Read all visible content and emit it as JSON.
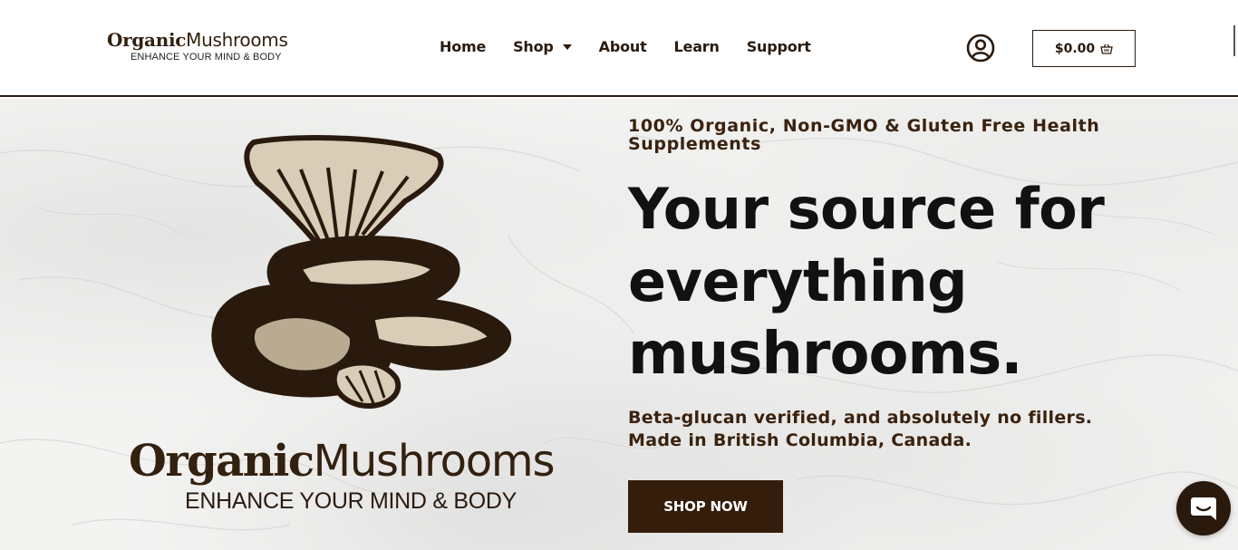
{
  "header": {
    "logo": {
      "title_bold": "Organic",
      "title_light": "Mushrooms",
      "tagline": "ENHANCE YOUR MIND & BODY"
    },
    "nav": [
      {
        "label": "Home"
      },
      {
        "label": "Shop",
        "has_dropdown": true
      },
      {
        "label": "About"
      },
      {
        "label": "Learn"
      },
      {
        "label": "Support"
      }
    ],
    "account_icon": "user-circle-icon",
    "cart": {
      "total": "$0.00",
      "icon": "basket-icon"
    }
  },
  "hero": {
    "eyebrow": "100% Organic, Non-GMO & Gluten Free Health Supplements",
    "headline": {
      "line1": "Your source for",
      "line2": "everything",
      "line3": "mushrooms."
    },
    "subtext_line1": "Beta-glucan verified, and absolutely no fillers.",
    "subtext_line2": "Made in British Columbia, Canada.",
    "cta_label": "SHOP NOW",
    "brand": {
      "title_bold": "Organic",
      "title_light": "Mushrooms",
      "tagline": "ENHANCE YOUR MIND & BODY"
    }
  },
  "chat": {
    "icon": "chat-bubble-icon"
  },
  "colors": {
    "brand_brown": "#341d0b",
    "text_dark": "#2a1a0e",
    "mushroom_light": "#d8cdb7",
    "mushroom_mid": "#b9ab92"
  }
}
